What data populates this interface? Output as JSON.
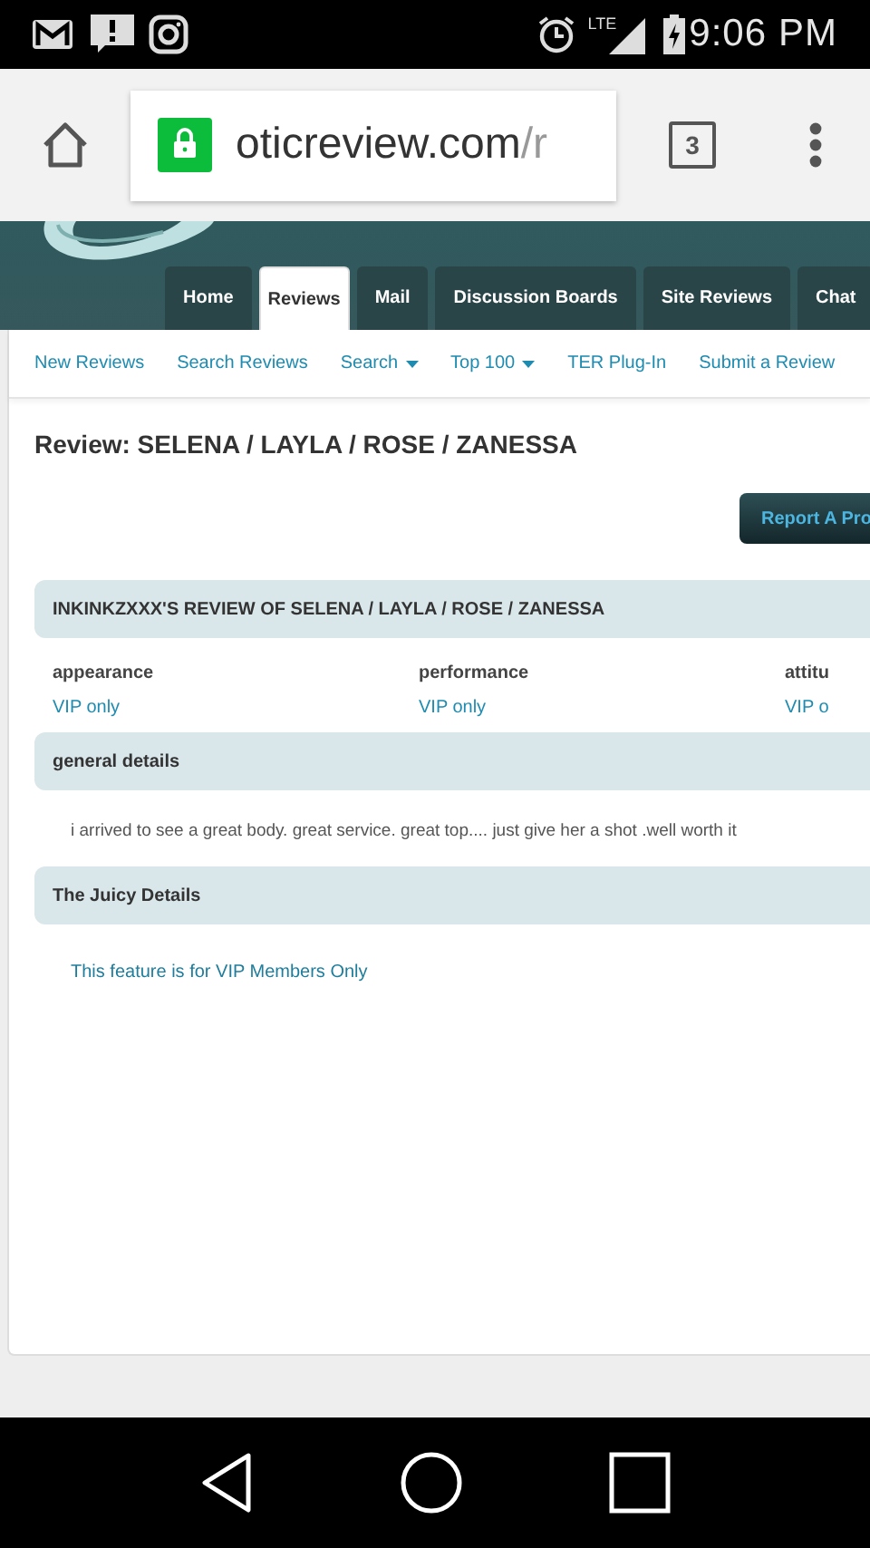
{
  "status_bar": {
    "network": "LTE",
    "time": "9:06 PM"
  },
  "browser": {
    "url_host": "oticreview.com",
    "url_path": "/r",
    "tab_count": "3"
  },
  "tabs": [
    {
      "label": "Home",
      "selected": false
    },
    {
      "label": "Reviews",
      "selected": true
    },
    {
      "label": "Mail",
      "selected": false
    },
    {
      "label": "Discussion Boards",
      "selected": false
    },
    {
      "label": "Site Reviews",
      "selected": false
    },
    {
      "label": "Chat",
      "selected": false
    }
  ],
  "subnav": [
    {
      "label": "New Reviews",
      "dropdown": false
    },
    {
      "label": "Search Reviews",
      "dropdown": false
    },
    {
      "label": "Search",
      "dropdown": true
    },
    {
      "label": "Top 100",
      "dropdown": true
    },
    {
      "label": "TER Plug-In",
      "dropdown": false
    },
    {
      "label": "Submit a Review",
      "dropdown": false
    }
  ],
  "page_title": "Review: SELENA / LAYLA / ROSE / ZANESSA",
  "report_button": "Report A Pro",
  "review_header": "INKINKZXXX'S REVIEW OF SELENA / LAYLA / ROSE / ZANESSA",
  "ratings": [
    {
      "label": "appearance",
      "value": "VIP only"
    },
    {
      "label": "performance",
      "value": "VIP only"
    },
    {
      "label": "attitu",
      "value": "VIP o"
    }
  ],
  "sections": [
    {
      "title": "general details",
      "kind": "text",
      "body": "i arrived to see a great body. great service. great top.... just give her a shot .well worth it"
    },
    {
      "title": "The Juicy Details",
      "kind": "link",
      "body": "This feature is for VIP Members Only"
    }
  ]
}
